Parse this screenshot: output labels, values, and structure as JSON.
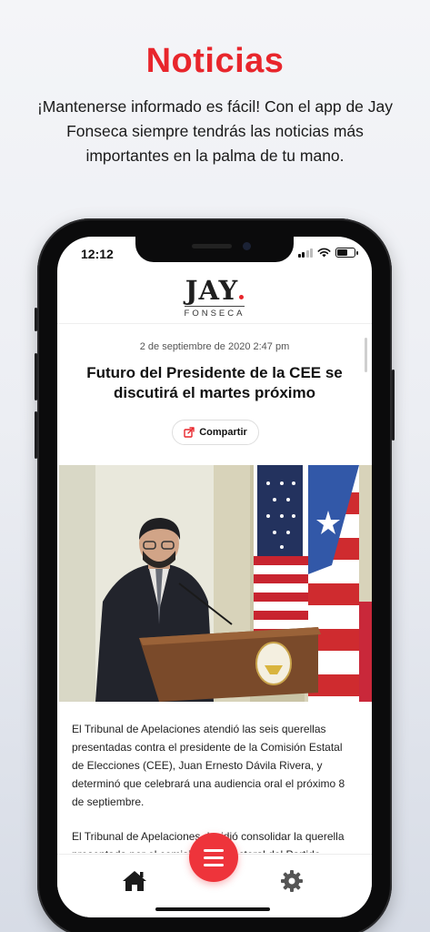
{
  "promo": {
    "title": "Noticias",
    "subtitle": "¡Mantenerse informado es fácil! Con el app de Jay Fonseca siempre tendrás las noticias más importantes en la palma de tu mano."
  },
  "status_bar": {
    "time": "12:12"
  },
  "header": {
    "logo_main": "JAY",
    "logo_sub": "FONSECA"
  },
  "article": {
    "date": "2 de septiembre de 2020 2:47 pm",
    "headline": "Futuro del Presidente de la CEE se discutirá el martes próximo",
    "share_label": "Compartir",
    "paragraphs": [
      "El Tribunal de Apelaciones atendió las seis querellas presentadas contra el presidente de la Comisión Estatal de Elecciones (CEE), Juan Ernesto Dávila Rivera, y determinó que celebrará una audiencia oral el próximo 8 de septiembre.",
      "El Tribunal de Apelaciones decidió consolidar la querella presentada por el comisionado electoral del Partido"
    ]
  },
  "bottom_nav": {
    "items": [
      "home-icon",
      "menu-icon",
      "settings-icon"
    ]
  },
  "colors": {
    "accent": "#e8262c",
    "fab": "#ee343b"
  }
}
